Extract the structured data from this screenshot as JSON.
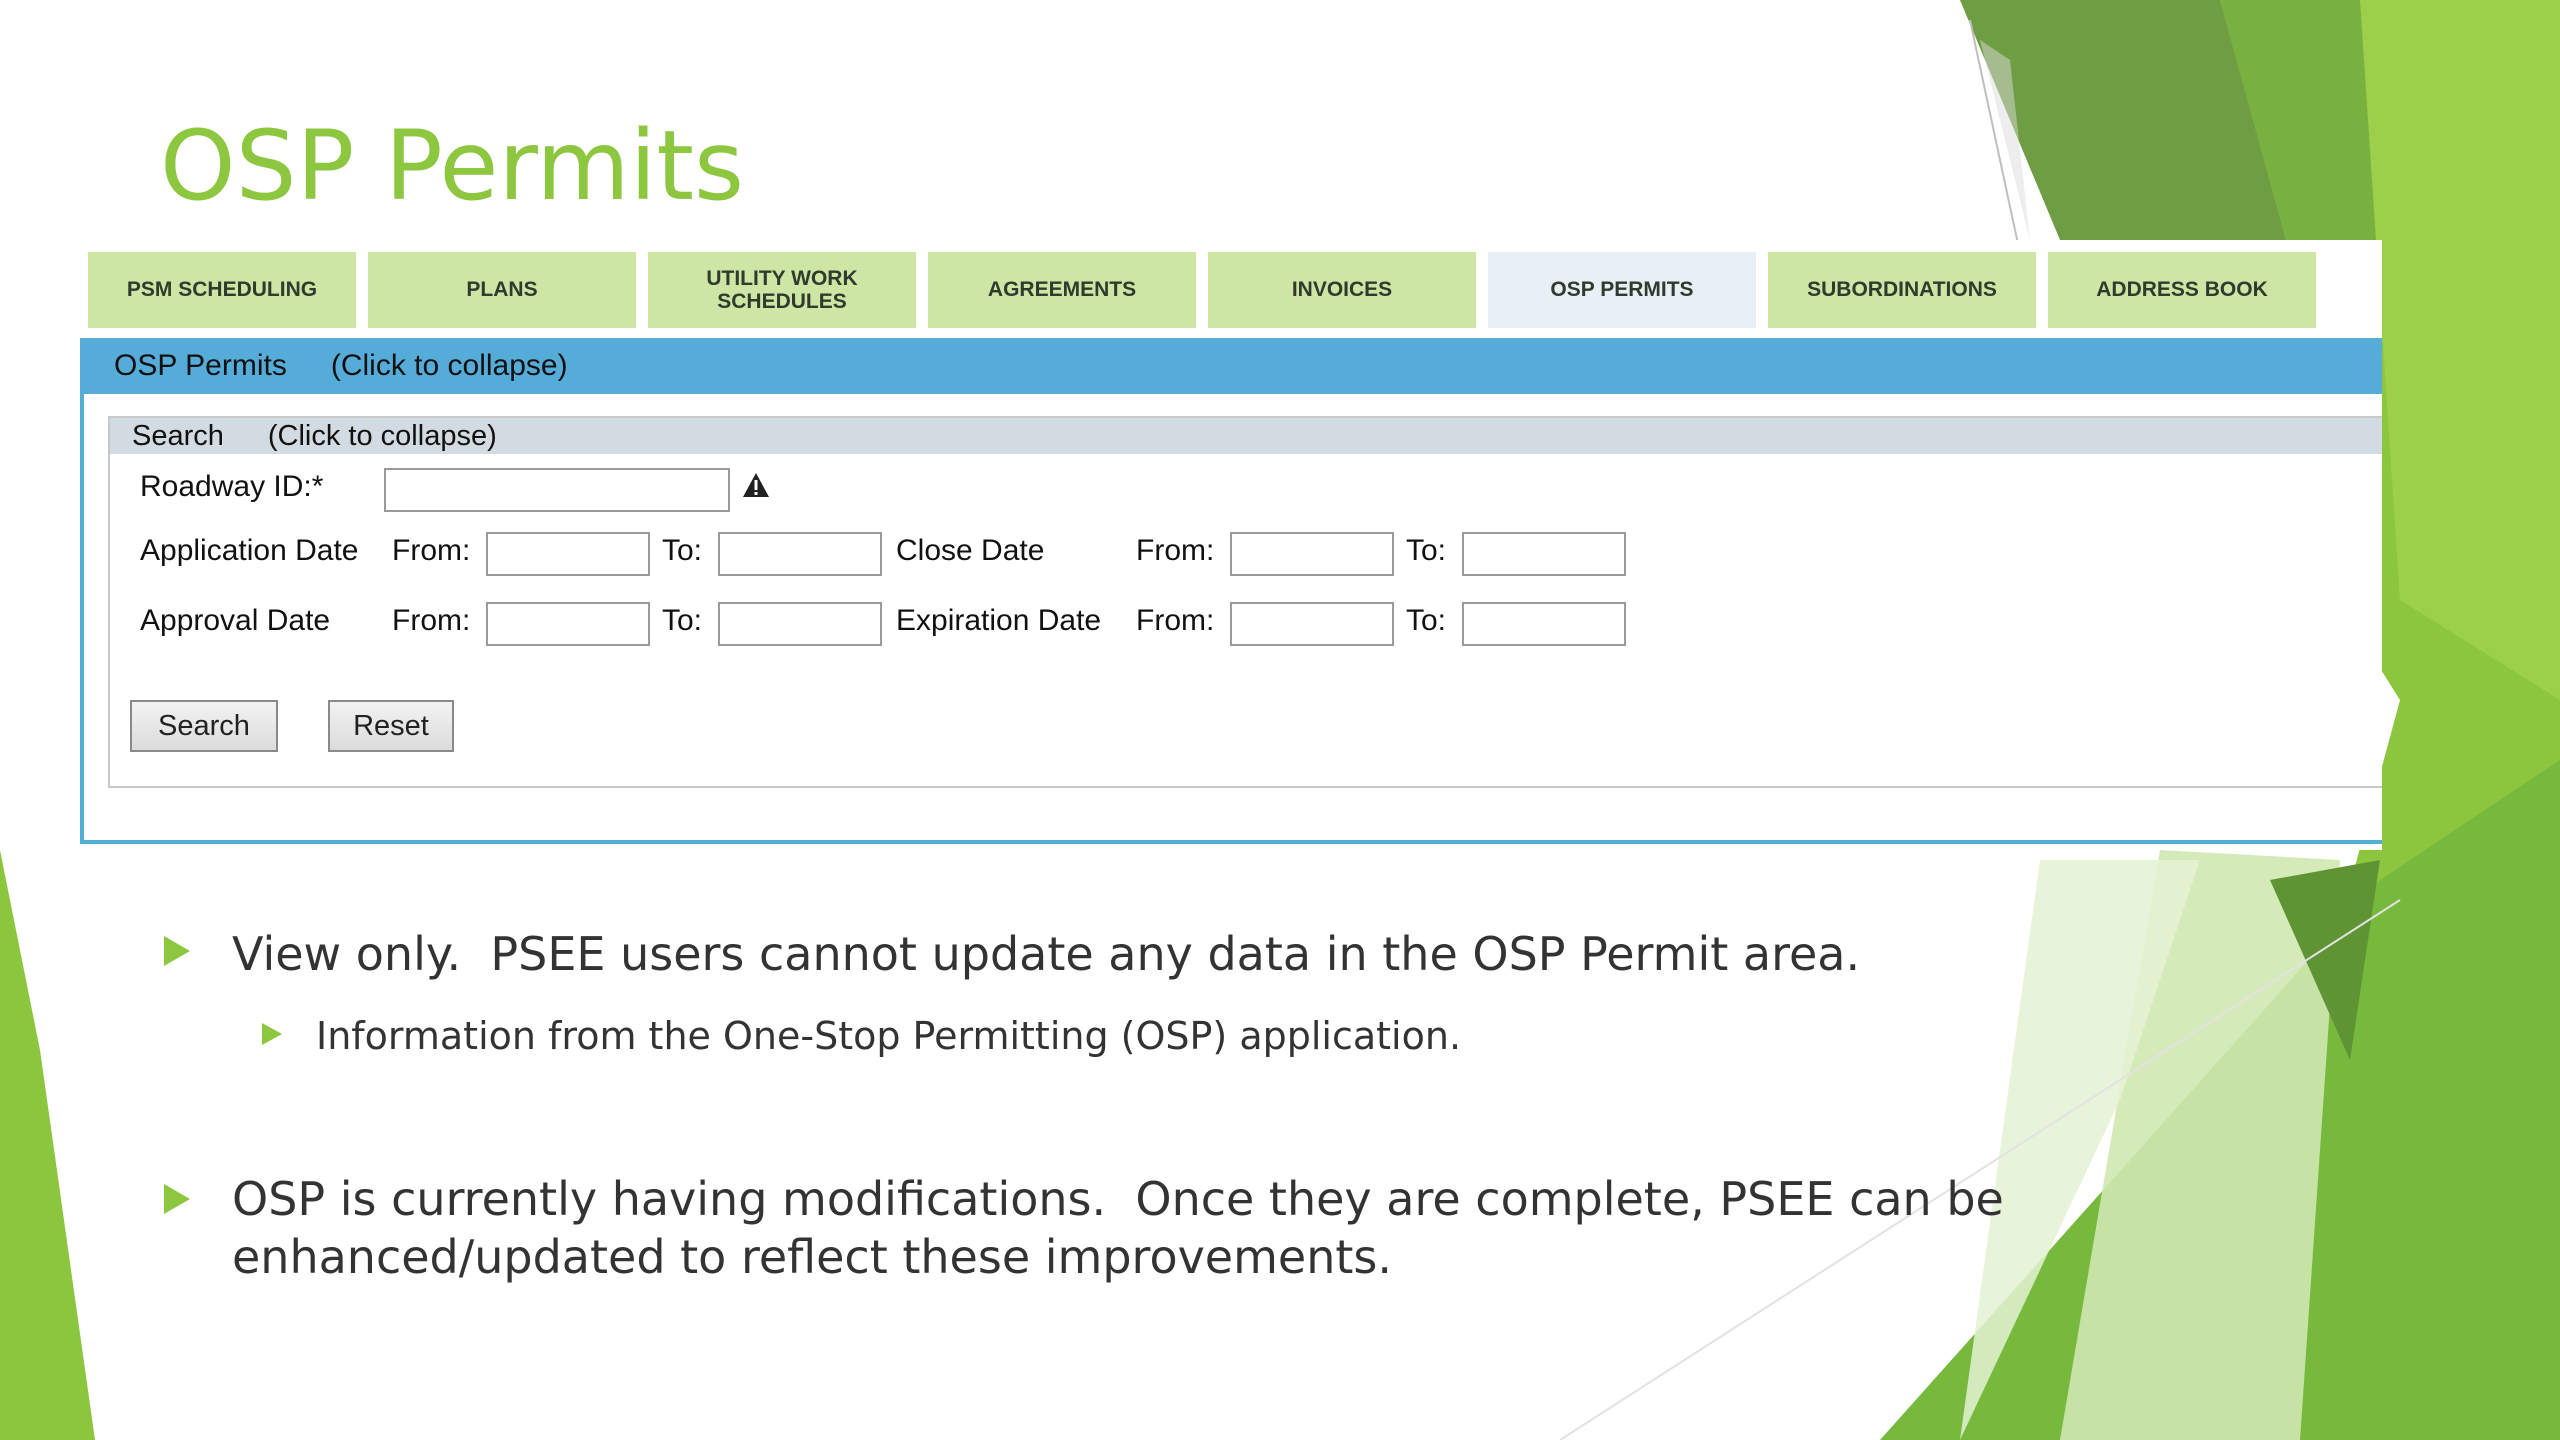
{
  "slide": {
    "title": "OSP Permits",
    "bullets": [
      {
        "text": "View only.  PSEE users cannot update any data in the OSP Permit area."
      },
      {
        "text": "Information from the One-Stop Permitting (OSP) application."
      },
      {
        "text": "OSP is currently having modifications.  Once they are complete, PSEE can be",
        "text2": "enhanced/updated to reflect these improvements."
      }
    ],
    "colors": {
      "accent": "#8dc63f",
      "tab_bg": "#cde6a3",
      "panel_header": "#56acd9"
    }
  },
  "app": {
    "tabs": [
      {
        "label": "PSM SCHEDULING"
      },
      {
        "label": "PLANS"
      },
      {
        "label": "UTILITY WORK SCHEDULES"
      },
      {
        "label": "AGREEMENTS"
      },
      {
        "label": "INVOICES"
      },
      {
        "label": "OSP PERMITS",
        "active": true
      },
      {
        "label": "SUBORDINATIONS"
      },
      {
        "label": "ADDRESS BOOK"
      }
    ],
    "panel": {
      "title": "OSP Permits",
      "toggle": "(Click to collapse)"
    },
    "search": {
      "title": "Search",
      "toggle": "(Click to collapse)",
      "roadway_label": "Roadway ID:*",
      "roadway_value": "",
      "warning_icon": "warning-icon",
      "application_date_label": "Application Date",
      "close_date_label": "Close Date",
      "approval_date_label": "Approval Date",
      "expiration_date_label": "Expiration Date",
      "from_label": "From:",
      "to_label": "To:",
      "search_button": "Search",
      "reset_button": "Reset"
    }
  }
}
